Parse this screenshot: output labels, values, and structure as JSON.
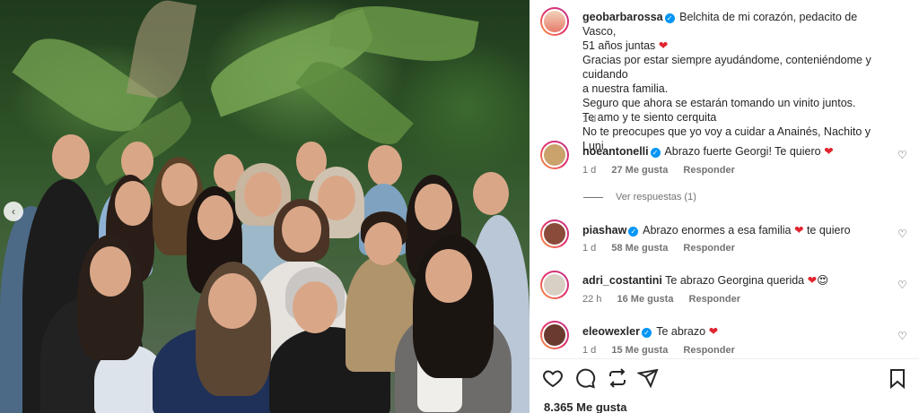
{
  "post": {
    "author": "geobarbarossa",
    "caption_lines": [
      "Belchita de mi corazón, pedacito de Vasco,",
      "51 años juntas",
      "Gracias por estar siempre ayudándome, conteniéndome y cuidando",
      "a nuestra familia.",
      "Seguro que ahora se estarán tomando un vinito juntos.",
      "Te amo y te siento cerquita",
      "No te preocupes que yo voy a cuidar a Anainés, Nachito y Luni."
    ],
    "time": "1 d",
    "likes": "8.365 Me gusta"
  },
  "comments": [
    {
      "user": "noeantonelli",
      "text": "Abrazo fuerte Georgi! Te quiero",
      "time": "1 d",
      "likes": "27 Me gusta",
      "reply": "Responder",
      "avatar_color": "#c9a36b"
    },
    {
      "user": "piashaw",
      "text": "Abrazo enormes a esa familia",
      "text_after": "te quiero",
      "time": "1 d",
      "likes": "58 Me gusta",
      "reply": "Responder",
      "avatar_color": "#8a4b3a"
    },
    {
      "user": "adri_costantini",
      "text": "Te abrazo Georgina querida",
      "time": "22 h",
      "likes": "16 Me gusta",
      "reply": "Responder",
      "avatar_color": "#d8d0c4"
    },
    {
      "user": "eleowexler",
      "text": "Te abrazo",
      "time": "1 d",
      "likes": "15 Me gusta",
      "reply": "Responder",
      "avatar_color": "#6b3a2e"
    }
  ],
  "view_replies": "Ver respuestas (1)",
  "icons": {
    "verified": "verified-badge-icon",
    "heart": "heart-icon",
    "comment": "comment-icon",
    "share": "share-icon",
    "save": "bookmark-icon"
  },
  "colors": {
    "verified": "#0095f6",
    "heart": "#e0242f",
    "muted": "#737373"
  }
}
